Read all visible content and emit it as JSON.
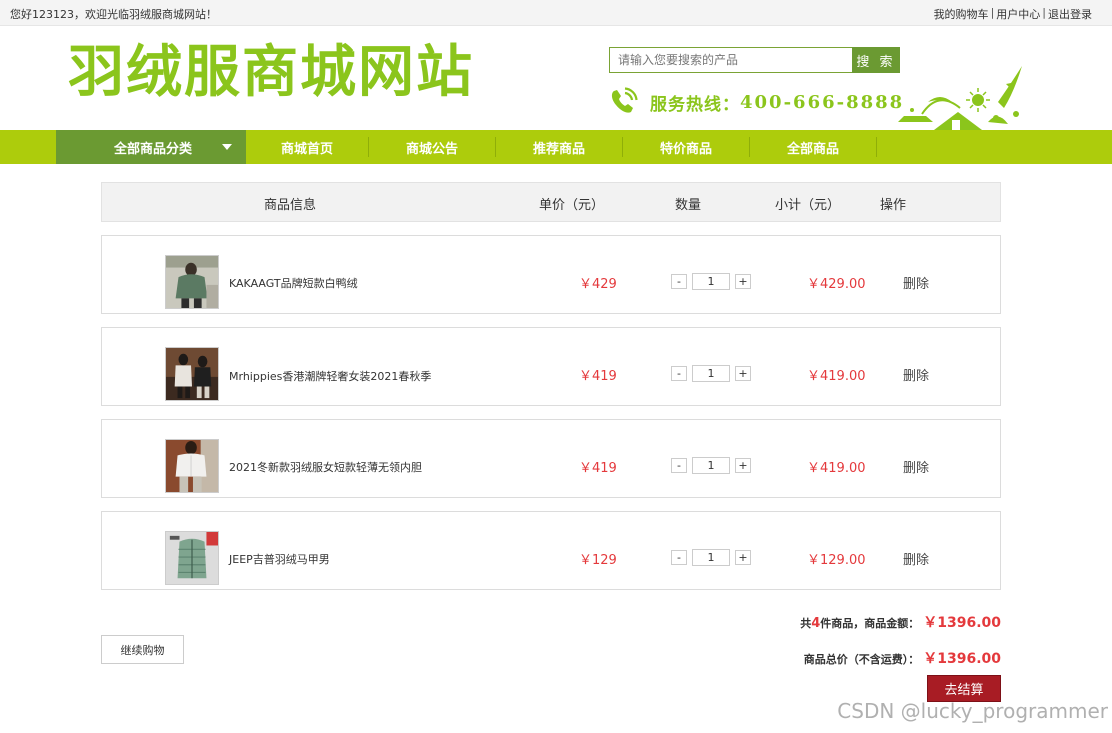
{
  "topbar": {
    "welcome": "您好123123，欢迎光临羽绒服商城网站！",
    "links": [
      "我的购物车",
      "用户中心",
      "退出登录"
    ]
  },
  "header": {
    "logo": "羽绒服商城网站",
    "search_placeholder": "请输入您要搜索的产品",
    "search_button": "搜 索",
    "hotline_label": "服务热线：",
    "hotline_number": "400-666-8888"
  },
  "nav": {
    "category": "全部商品分类",
    "items": [
      "商城首页",
      "商城公告",
      "推荐商品",
      "特价商品",
      "全部商品"
    ]
  },
  "cart": {
    "headers": {
      "info": "商品信息",
      "price": "单价（元）",
      "qty": "数量",
      "subtotal": "小计（元）",
      "action": "操作"
    },
    "items": [
      {
        "name": "KAKAAGT品牌短款白鸭绒",
        "price": "￥429",
        "qty": "1",
        "subtotal": "￥429.00",
        "action": "删除"
      },
      {
        "name": "Mrhippies香港潮牌轻奢女装2021春秋季",
        "price": "￥419",
        "qty": "1",
        "subtotal": "￥419.00",
        "action": "删除"
      },
      {
        "name": "2021冬新款羽绒服女短款轻薄无领内胆",
        "price": "￥419",
        "qty": "1",
        "subtotal": "￥419.00",
        "action": "删除"
      },
      {
        "name": "JEEP吉普羽绒马甲男",
        "price": "￥129",
        "qty": "1",
        "subtotal": "￥129.00",
        "action": "删除"
      }
    ],
    "minus_label": "-",
    "plus_label": "+"
  },
  "summary": {
    "count_prefix": "共",
    "count": "4",
    "count_suffix": "件商品，商品金额：",
    "amount": "￥1396.00",
    "total_label": "商品总价（不含运费）：",
    "total": "￥1396.00"
  },
  "buttons": {
    "continue": "继续购物",
    "checkout": "去结算"
  },
  "watermark": "CSDN @lucky_programmer",
  "colors": {
    "brand_green": "#8bc51c",
    "nav_green": "#adcc0c",
    "dark_green": "#6b9a32",
    "price_red": "#e4393c",
    "checkout_red": "#a81c24"
  }
}
